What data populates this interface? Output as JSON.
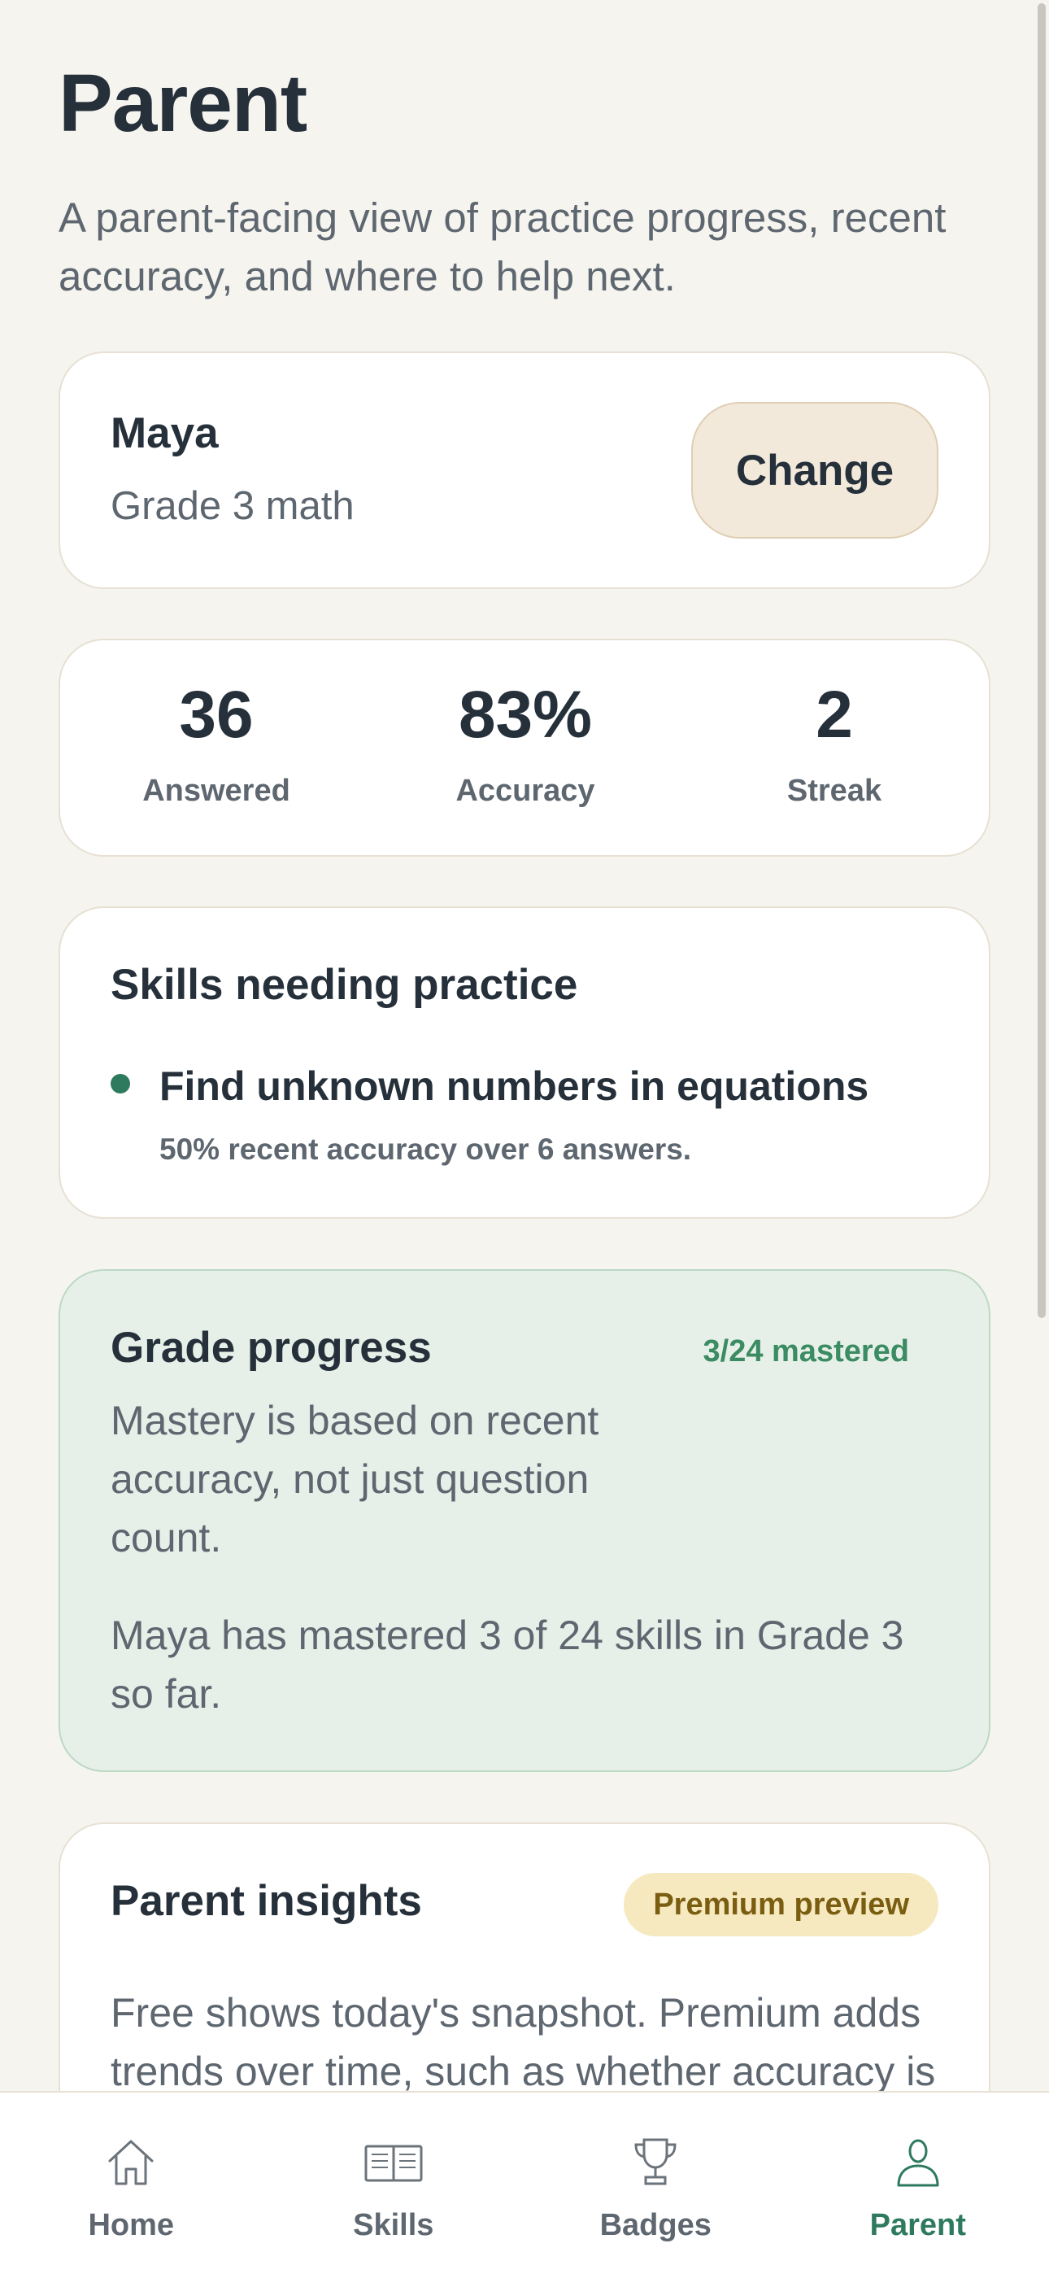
{
  "header": {
    "title": "Parent",
    "subtitle": "A parent-facing view of practice progress, recent accuracy, and where to help next."
  },
  "child": {
    "name": "Maya",
    "grade": "Grade 3 math",
    "change_label": "Change"
  },
  "stats": [
    {
      "value": "36",
      "label": "Answered"
    },
    {
      "value": "83%",
      "label": "Accuracy"
    },
    {
      "value": "2",
      "label": "Streak"
    }
  ],
  "skills_needing_practice": {
    "title": "Skills needing practice",
    "items": [
      {
        "name": "Find unknown numbers in equations",
        "meta": "50% recent accuracy over 6 answers."
      }
    ]
  },
  "grade_progress": {
    "title": "Grade progress",
    "badge": "3/24 mastered",
    "description": "Mastery is based on recent accuracy, not just question count.",
    "summary": "Maya has mastered 3 of 24 skills in Grade 3 so far."
  },
  "parent_insights": {
    "title": "Parent insights",
    "badge": "Premium preview",
    "text": "Free shows today's snapshot. Premium adds trends over time, such as whether accuracy is"
  },
  "nav": {
    "items": [
      {
        "label": "Home",
        "icon": "home-icon"
      },
      {
        "label": "Skills",
        "icon": "book-icon"
      },
      {
        "label": "Badges",
        "icon": "trophy-icon"
      },
      {
        "label": "Parent",
        "icon": "person-icon",
        "active": true
      }
    ]
  },
  "colors": {
    "background": "#f6f4ef",
    "accent": "#2e7a5e",
    "progress_bg": "#e6f0e8",
    "premium_bg": "#f6e9bf",
    "change_bg": "#f2e9da"
  }
}
